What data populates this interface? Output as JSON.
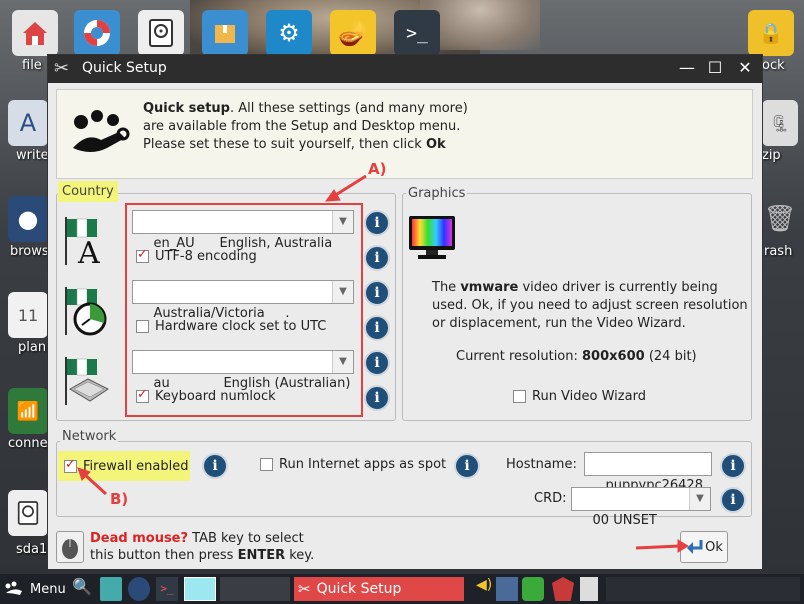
{
  "desktop": {
    "icons": [
      {
        "label": "file",
        "icon": "home-icon"
      },
      {
        "label": "write",
        "icon": "abiword-icon"
      },
      {
        "label": "brows",
        "icon": "globe-icon"
      },
      {
        "label": "plan",
        "icon": "calendar-icon"
      },
      {
        "label": "conne",
        "icon": "antenna-icon"
      },
      {
        "label": "sda1",
        "icon": "drive-icon"
      },
      {
        "label": "ock",
        "icon": "lock-icon"
      },
      {
        "label": "zip",
        "icon": "zip-icon"
      },
      {
        "label": "rash",
        "icon": "trash-icon"
      }
    ]
  },
  "window": {
    "title": "Quick Setup",
    "intro_bold": "Quick setup",
    "intro_text": ". All these settings (and many more) are available from the Setup and Desktop menu. Please set these to suit yourself, then click ",
    "intro_ok": "Ok"
  },
  "country": {
    "legend": "Country",
    "locale_value": "en_AU      English, Australia",
    "utf8_label": "UTF-8 encoding",
    "utf8_checked": true,
    "timezone_value": "Australia/Victoria     .",
    "hwclock_label": "Hardware clock set to UTC",
    "hwclock_checked": false,
    "keyboard_value": "au             English (Australian)",
    "numlock_label": "Keyboard numlock",
    "numlock_checked": true
  },
  "graphics": {
    "legend": "Graphics",
    "text_pre": "The ",
    "driver": "vmware",
    "text_post": " video driver is currently being used. Ok, if you need to adjust screen resolution or displacement, run the Video Wizard.",
    "resolution_label": "Current resolution: ",
    "resolution": "800x600",
    "depth": "(24 bit)",
    "wizard_label": "Run Video Wizard",
    "wizard_checked": false
  },
  "network": {
    "legend": "Network",
    "firewall_label": "Firewall enabled",
    "firewall_checked": true,
    "spot_label": "Run Internet apps as spot",
    "spot_checked": false,
    "hostname_label": "Hostname:",
    "hostname_value": "puppypc26428",
    "crd_label": "CRD:",
    "crd_value": "00 UNSET"
  },
  "footer": {
    "dead_mouse": "Dead mouse?",
    "hint1": " TAB key to select",
    "hint2a": "this button then press ",
    "hint2b": "ENTER",
    "hint2c": " key.",
    "ok_label": "Ok"
  },
  "annotations": {
    "a": "A)",
    "b": "B)"
  },
  "taskbar": {
    "menu_label": "Menu",
    "active_task": "Quick Setup"
  },
  "colors": {
    "annotation": "#e53f3f",
    "highlight": "#f3f47a",
    "task_active": "#e04848"
  }
}
